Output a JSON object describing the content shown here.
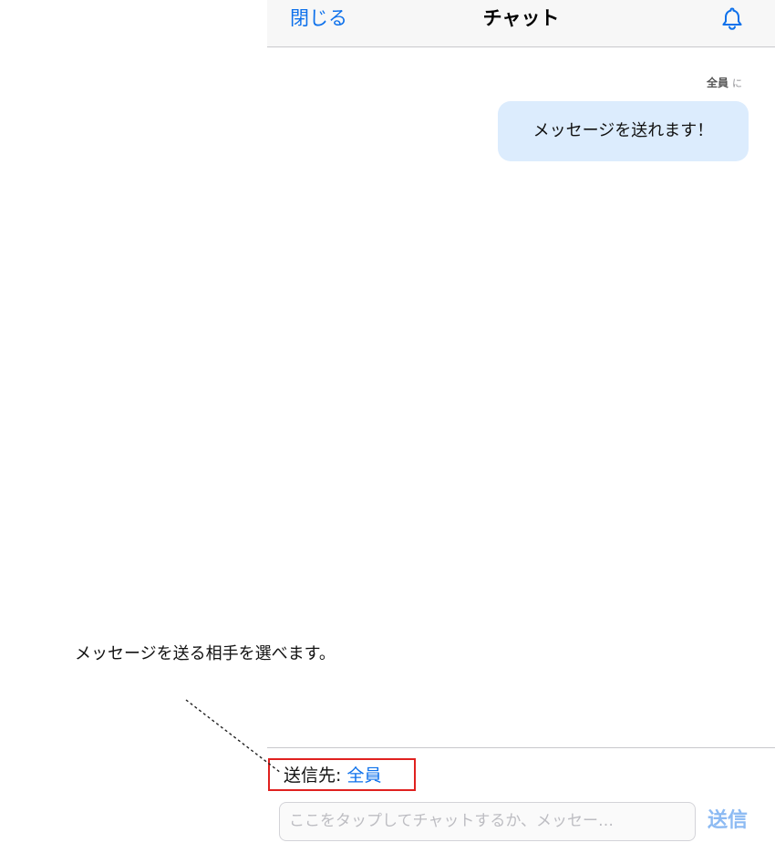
{
  "nav": {
    "close_label": "閉じる",
    "title": "チャット",
    "bell_icon": "bell-icon"
  },
  "message": {
    "to_name": "全員",
    "to_suffix": "に",
    "text": "メッセージを送れます！"
  },
  "composer": {
    "recipient_label": "送信先:",
    "recipient_value": "全員",
    "input_placeholder": "ここをタップしてチャットするか、メッセー…",
    "send_label": "送信"
  },
  "annotation": {
    "text": "メッセージを送る相手を選べます。"
  },
  "colors": {
    "accent": "#0e71eb",
    "bubble": "#dcecfd",
    "highlight": "#e0211f",
    "send_disabled": "#8cbaf3"
  }
}
